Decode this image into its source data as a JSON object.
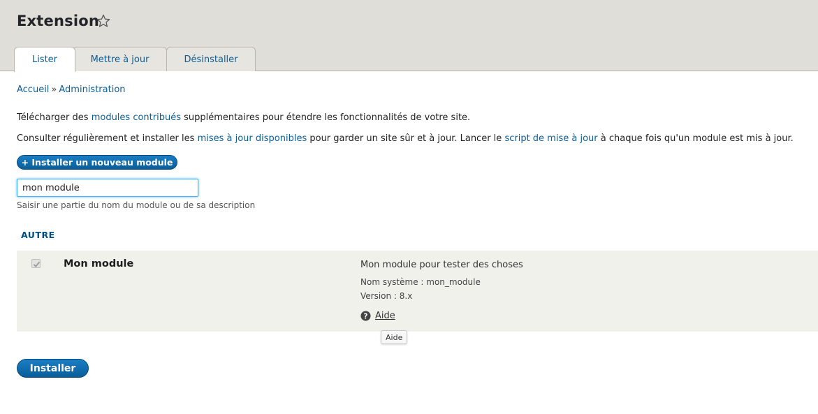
{
  "header": {
    "title": "Extension",
    "tabs": [
      {
        "label": "Lister",
        "active": true
      },
      {
        "label": "Mettre à jour",
        "active": false
      },
      {
        "label": "Désinstaller",
        "active": false
      }
    ]
  },
  "breadcrumb": {
    "items": [
      "Accueil",
      "Administration"
    ],
    "separator": "»"
  },
  "intro": {
    "line1_prefix": "Télécharger des ",
    "line1_link": "modules contribués",
    "line1_suffix": " supplémentaires pour étendre les fonctionnalités de votre site.",
    "line2_prefix": "Consulter régulièrement et installer les ",
    "line2_link1": "mises à jour disponibles",
    "line2_middle": " pour garder un site sûr et à jour. Lancer le ",
    "line2_link2": "script de mise à jour",
    "line2_suffix": " à chaque fois qu'un module est mis à jour."
  },
  "add_button": {
    "label": "+ Installer un nouveau module"
  },
  "filter": {
    "value": "mon module",
    "help": "Saisir une partie du nom du module ou de sa description"
  },
  "section": {
    "title": "AUTRE"
  },
  "module": {
    "checked": true,
    "disabled": true,
    "name": "Mon module",
    "description": "Mon module pour tester des choses",
    "machine_name": "Nom système : mon_module",
    "version": "Version : 8.x",
    "help_label": "Aide"
  },
  "tooltip": {
    "text": "Aide"
  },
  "install_button": {
    "label": "Installer"
  },
  "colors": {
    "link": "#0a5e99",
    "header_bg": "#e0ded8",
    "button": "#0a5e99",
    "row_bg": "#f1f1ec"
  }
}
